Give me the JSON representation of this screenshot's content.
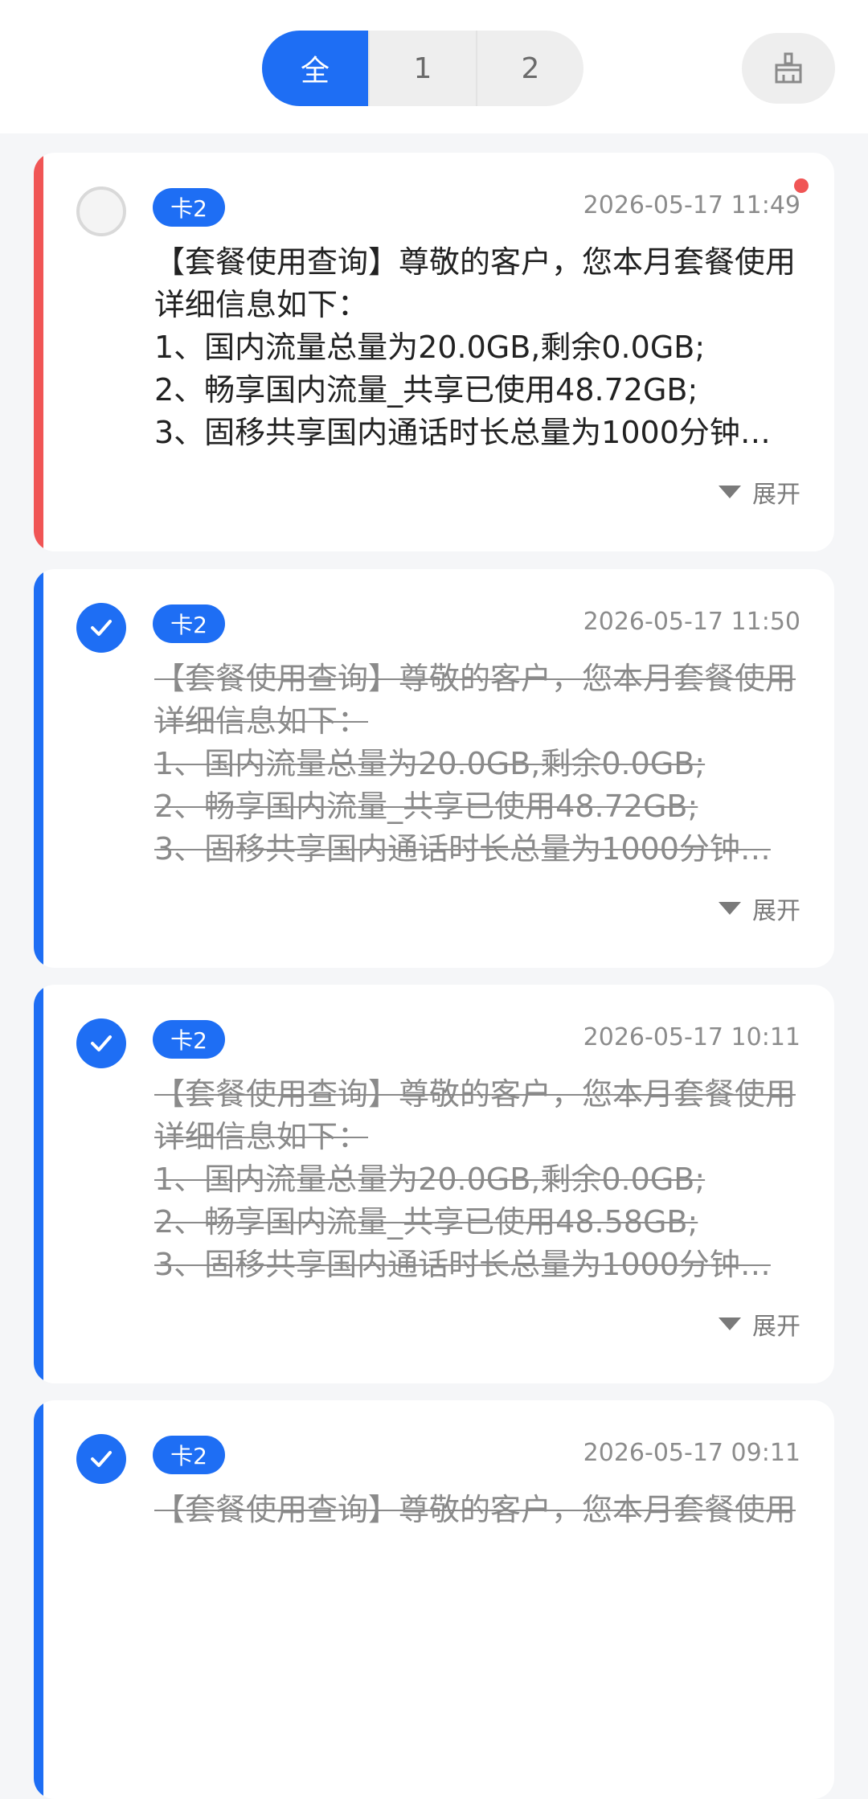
{
  "tabs": [
    {
      "label": "全",
      "active": true
    },
    {
      "label": "1",
      "active": false
    },
    {
      "label": "2",
      "active": false
    }
  ],
  "clean_button": {
    "icon": "broom-icon"
  },
  "messages": [
    {
      "read": false,
      "accent_color": "#f05555",
      "badge": "卡2",
      "time": "2026-05-17 11:49",
      "lines": [
        "【套餐使用查询】尊敬的客户，您本月套餐使用",
        "详细信息如下：",
        "1、国内流量总量为20.0GB,剩余0.0GB;",
        "2、畅享国内流量_共享已使用48.72GB;",
        "3、固移共享国内通话时长总量为1000分钟…"
      ],
      "expand_label": "展开"
    },
    {
      "read": true,
      "accent_color": "#1e6ef4",
      "badge": "卡2",
      "time": "2026-05-17 11:50",
      "lines": [
        "【套餐使用查询】尊敬的客户，您本月套餐使用",
        "详细信息如下：",
        "1、国内流量总量为20.0GB,剩余0.0GB;",
        "2、畅享国内流量_共享已使用48.72GB;",
        "3、固移共享国内通话时长总量为1000分钟…"
      ],
      "expand_label": "展开"
    },
    {
      "read": true,
      "accent_color": "#1e6ef4",
      "badge": "卡2",
      "time": "2026-05-17 10:11",
      "lines": [
        "【套餐使用查询】尊敬的客户，您本月套餐使用",
        "详细信息如下：",
        "1、国内流量总量为20.0GB,剩余0.0GB;",
        "2、畅享国内流量_共享已使用48.58GB;",
        "3、固移共享国内通话时长总量为1000分钟…"
      ],
      "expand_label": "展开"
    },
    {
      "read": true,
      "accent_color": "#1e6ef4",
      "badge": "卡2",
      "time": "2026-05-17 09:11",
      "lines": [
        "【套餐使用查询】尊敬的客户，您本月套餐使用",
        "",
        "",
        "",
        ""
      ],
      "expand_label": ""
    }
  ]
}
